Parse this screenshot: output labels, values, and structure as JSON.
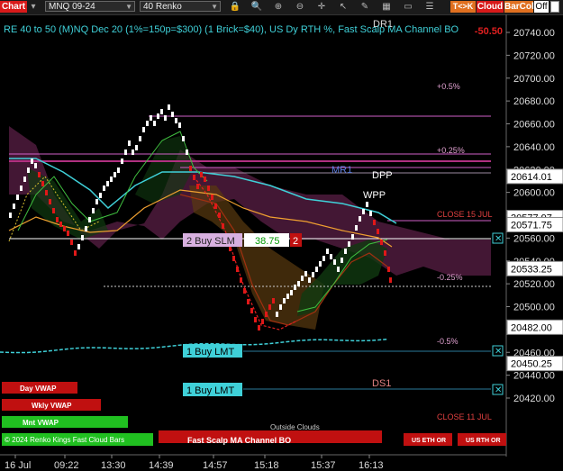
{
  "toolbar": {
    "chart_label": "Chart",
    "instrument": "MNQ 09-24",
    "bar_type": "40 Renko",
    "tool_icons": [
      "lock-icon",
      "magnifier-icon",
      "zoom-in-icon",
      "zoom-out-icon",
      "crosshair-icon",
      "cursor-icon",
      "pencil-icon",
      "grid-icon",
      "data-box-icon",
      "properties-icon"
    ],
    "tk_label": "T<>K",
    "cloud_label": "Cloud",
    "barcol_label": "BarCol",
    "off_label": "Off",
    "colors": {
      "tk": "#e07020",
      "cloud": "#d81a1a",
      "barcol": "#e07020",
      "off": "#ffffff"
    }
  },
  "chart": {
    "title": "RE 40 to 50 (M)NQ Dec 20 (1%=150p=$300) (1 Brick=$40), US Dy RTH %, Fast Scalp MA Channel BO",
    "top_right_value": "-50.50",
    "y_axis": {
      "ticks": [
        "20740.00",
        "20720.00",
        "20700.00",
        "20680.00",
        "20660.00",
        "20640.00",
        "20620.00",
        "20600.00",
        "20580.00",
        "20560.00",
        "20540.00",
        "20520.00",
        "20500.00",
        "20480.00",
        "20460.00",
        "20440.00",
        "20420.00"
      ],
      "price_flags": [
        {
          "value": "20614.01",
          "bg": "#ffffff",
          "fg": "#000000"
        },
        {
          "value": "20577.97",
          "bg": "#ffffff",
          "fg": "#000000"
        },
        {
          "value": "20571.75",
          "bg": "#ffffff",
          "fg": "#000000"
        },
        {
          "value": "20533.25",
          "bg": "#ffffff",
          "fg": "#000000"
        },
        {
          "value": "20482.00",
          "bg": "#ffffff",
          "fg": "#000000"
        },
        {
          "value": "20450.25",
          "bg": "#ffffff",
          "fg": "#000000"
        }
      ]
    },
    "x_axis": {
      "ticks": [
        "16 Jul",
        "09:22",
        "13:30",
        "14:39",
        "14:57",
        "15:18",
        "15:37",
        "16:13"
      ]
    },
    "level_labels": {
      "dr1": "DR1",
      "plus05": "+0.5%",
      "plus025": "+0.25%",
      "mr1": "MR1",
      "dpp": "DPP",
      "wpp": "WPP",
      "close15": "CLOSE 15 JUL",
      "minus025": "-0.25%",
      "minus05": "-0.5%",
      "ds1": "DS1",
      "close11": "CLOSE 11 JUL",
      "outside_clouds": "Outside Clouds"
    },
    "orders": [
      {
        "side": "Buy",
        "type": "SLM",
        "qty": "2",
        "label": "2 Buy SLM",
        "price": "38.75",
        "count": "2"
      },
      {
        "side": "Buy",
        "type": "LMT",
        "qty": "1",
        "label": "1 Buy LMT"
      },
      {
        "side": "Buy",
        "type": "LMT",
        "qty": "1",
        "label": "1 Buy LMT"
      }
    ],
    "status_buttons": {
      "day_vwap": "Day VWAP",
      "wkly_vwap": "Wkly VWAP",
      "mnt_vwap": "Mnt VWAP",
      "fast_scalp": "Fast Scalp MA Channel BO",
      "us_eth": "US ETH OR",
      "us_rth": "US RTH OR"
    },
    "copyright": "© 2024 Renko Kings Fast Cloud Bars",
    "colors": {
      "up_brick": "#ffffff",
      "down_brick": "#e01818",
      "cloud_purple": "#4a1a3a",
      "cloud_orange": "#5a3a10",
      "cloud_green": "#103a10",
      "cyan": "#3fd0d8",
      "magenta": "#d060c8",
      "orange": "#f0a030",
      "green": "#40c040",
      "red_dash": "#e02020"
    }
  }
}
